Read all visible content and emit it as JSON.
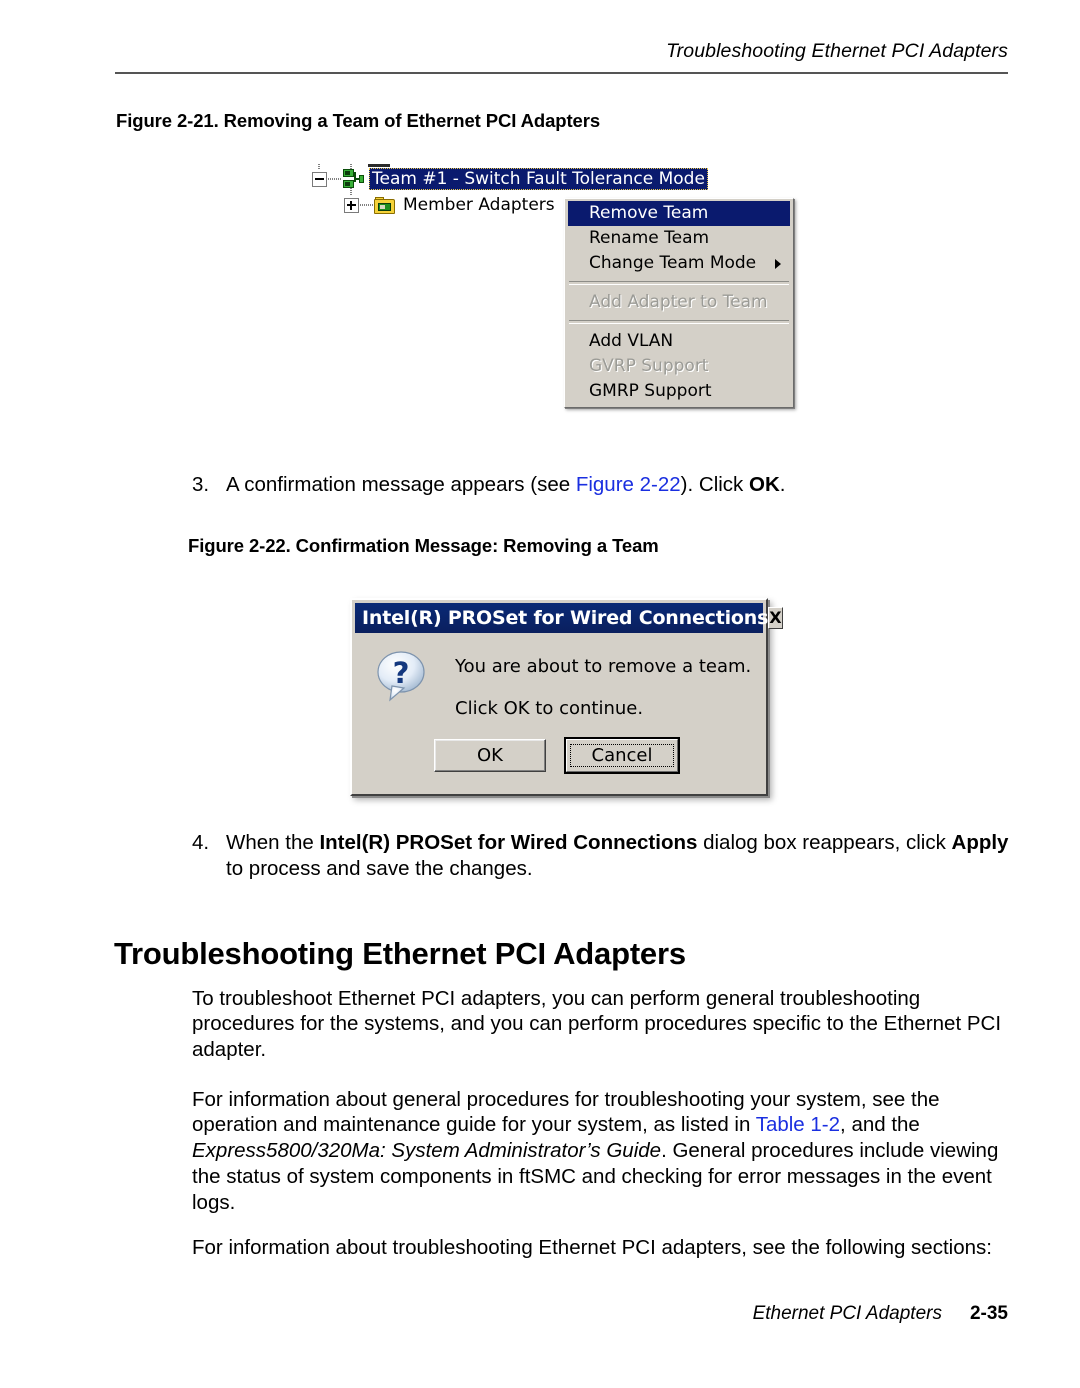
{
  "header": {
    "running_title": "Troubleshooting Ethernet PCI Adapters"
  },
  "figures": {
    "fig221": {
      "caption": "Figure 2-21. Removing a Team of Ethernet PCI Adapters",
      "tree": {
        "team_label": "Team #1 - Switch Fault Tolerance Mode",
        "members_label": "Member Adapters"
      },
      "context_menu": {
        "items": [
          {
            "label": "Remove Team",
            "state": "highlighted"
          },
          {
            "label": "Rename Team",
            "state": "normal"
          },
          {
            "label": "Change Team Mode",
            "state": "submenu"
          },
          {
            "label": "Add Adapter to Team",
            "state": "disabled"
          },
          {
            "label": "Add VLAN",
            "state": "normal"
          },
          {
            "label": "GVRP Support",
            "state": "disabled"
          },
          {
            "label": "GMRP Support",
            "state": "normal"
          }
        ]
      }
    },
    "fig222": {
      "caption": "Figure 2-22. Confirmation Message: Removing a Team",
      "dialog": {
        "title": "Intel(R) PROSet for Wired Connections",
        "close_label": "X",
        "message_line1": "You are about to remove a team.",
        "message_line2": "Click OK to continue.",
        "ok_label": "OK",
        "cancel_label": "Cancel"
      }
    }
  },
  "steps": {
    "step3": {
      "number": "3.",
      "part1": "A confirmation message appears (see ",
      "link": "Figure 2-22",
      "part2": "). Click ",
      "bold": "OK",
      "part3": "."
    },
    "step4": {
      "number": "4.",
      "part1": "When the ",
      "bold1": "Intel(R) PROSet for Wired Connections",
      "part2": " dialog box reappears, click ",
      "bold2": "Apply",
      "part3": " to process and save the changes."
    }
  },
  "section": {
    "heading": "Troubleshooting Ethernet PCI Adapters",
    "paragraph1": "To troubleshoot Ethernet PCI adapters, you can perform general troubleshooting procedures for the systems, and you can perform procedures specific to the Ethernet PCI adapter.",
    "paragraph2": {
      "part1": "For information about general procedures for troubleshooting your system, see the operation and maintenance guide for your system, as listed in ",
      "link": "Table 1-2",
      "part2": ", and the ",
      "italic": "Express5800/320Ma: System Administrator’s Guide",
      "part3": ". General procedures include viewing the status of system components in ftSMC and checking for error messages in the event logs."
    },
    "paragraph3": "For information about troubleshooting Ethernet PCI adapters, see the following sections:"
  },
  "footer": {
    "title": "Ethernet PCI Adapters",
    "page": "2-35"
  },
  "colors": {
    "link": "#1a2fe0",
    "selection": "#0a1a6e",
    "dialog_face": "#d4d0c8",
    "titlebar": "#0a1f5e"
  }
}
